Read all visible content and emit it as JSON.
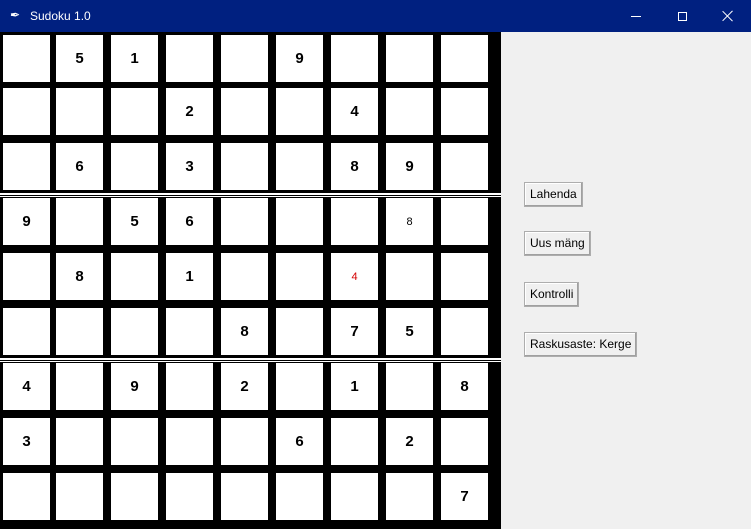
{
  "window": {
    "title": "Sudoku 1.0",
    "icon": "feather-icon",
    "controls": [
      "minimize-icon",
      "maximize-icon",
      "close-icon"
    ]
  },
  "board": {
    "rows": [
      [
        "",
        "5",
        "1",
        "",
        "",
        "9",
        "",
        "",
        ""
      ],
      [
        "",
        "",
        "",
        "2",
        "",
        "",
        "4",
        "",
        ""
      ],
      [
        "",
        "6",
        "",
        "3",
        "",
        "",
        "8",
        "9",
        ""
      ],
      [
        "9",
        "",
        "5",
        "6",
        "",
        "",
        "",
        "8",
        ""
      ],
      [
        "",
        "8",
        "",
        "1",
        "",
        "",
        "4",
        "",
        ""
      ],
      [
        "",
        "",
        "",
        "",
        "8",
        "",
        "7",
        "5",
        ""
      ],
      [
        "4",
        "",
        "9",
        "",
        "2",
        "",
        "1",
        "",
        "8"
      ],
      [
        "3",
        "",
        "",
        "",
        "",
        "6",
        "",
        "2",
        ""
      ],
      [
        "",
        "",
        "",
        "",
        "",
        "",
        "",
        "",
        "7"
      ]
    ],
    "hint_cells": [
      [
        3,
        7
      ]
    ],
    "error_cells": [
      [
        4,
        6
      ]
    ],
    "colors": {
      "given": "#000000",
      "hint": "#000000",
      "error": "#d40000",
      "grid": "#000000"
    }
  },
  "controls": {
    "solve_label": "Lahenda",
    "new_game_label": "Uus mäng",
    "check_label": "Kontrolli",
    "difficulty_label": "Raskusaste: Kerge"
  },
  "colors": {
    "titlebar": "#002080",
    "background": "#f0f0f0"
  }
}
